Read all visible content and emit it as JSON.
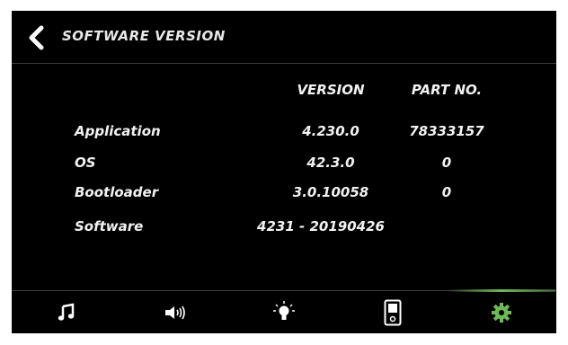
{
  "header": {
    "title": "SOFTWARE VERSION"
  },
  "table": {
    "columns": [
      "VERSION",
      "PART NO."
    ],
    "rows": [
      {
        "label": "Application",
        "version": "4.230.0",
        "part_no": "78333157"
      },
      {
        "label": "OS",
        "version": "42.3.0",
        "part_no": "0"
      },
      {
        "label": "Bootloader",
        "version": "3.0.10058",
        "part_no": "0"
      },
      {
        "label": "Software",
        "version": "4231 - 20190426",
        "part_no": ""
      }
    ]
  },
  "nav": {
    "items": [
      {
        "icon": "music-note-icon"
      },
      {
        "icon": "speaker-volume-icon"
      },
      {
        "icon": "light-bulb-icon"
      },
      {
        "icon": "switch-panel-icon"
      },
      {
        "icon": "gear-icon",
        "active": true
      }
    ],
    "accent_color": "#6fb85a"
  }
}
